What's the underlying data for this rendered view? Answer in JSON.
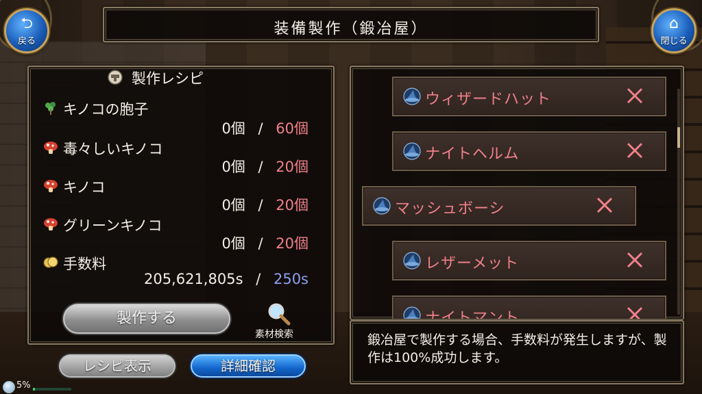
{
  "window": {
    "title": "装備製作（鍛冶屋）"
  },
  "nav": {
    "back": {
      "label": "戻る",
      "icon": "back-arrow-icon"
    },
    "close": {
      "label": "閉じる",
      "icon": "home-icon"
    }
  },
  "recipe": {
    "title": "製作レシピ",
    "materials": [
      {
        "name": "キノコの胞子",
        "have": "0個",
        "sep": "/",
        "need": "60個",
        "icon": "spore-icon"
      },
      {
        "name": "毒々しいキノコ",
        "have": "0個",
        "sep": "/",
        "need": "20個",
        "icon": "mushroom-icon"
      },
      {
        "name": "キノコ",
        "have": "0個",
        "sep": "/",
        "need": "20個",
        "icon": "mushroom-icon"
      },
      {
        "name": "グリーンキノコ",
        "have": "0個",
        "sep": "/",
        "need": "20個",
        "icon": "mushroom-icon"
      }
    ],
    "fee": {
      "name": "手数料",
      "have": "205,621,805s",
      "sep": "/",
      "need": "250s",
      "icon": "coin-icon"
    },
    "make_button": "製作する",
    "search_label": "素材検索"
  },
  "bottom_buttons": {
    "show_recipe": "レシピ表示",
    "details": "詳細確認"
  },
  "status": {
    "percent": "5%",
    "level": 0.05
  },
  "equipment_list": [
    {
      "name": "ウィザードハット",
      "icon": "hat-icon",
      "selected": false
    },
    {
      "name": "ナイトヘルム",
      "icon": "hat-icon",
      "selected": false
    },
    {
      "name": "マッシュボーシ",
      "icon": "hat-icon",
      "selected": true
    },
    {
      "name": "レザーメット",
      "icon": "hat-icon",
      "selected": false
    },
    {
      "name": "ナイトマント",
      "icon": "hat-icon",
      "selected": false
    }
  ],
  "message": "鍛冶屋で製作する場合、手数料が発生しますが、製作は100%成功します。",
  "colors": {
    "required_red": "#f0808a",
    "fee_blue": "#8f9ff0",
    "item_name_red": "#f0808a",
    "button_blue": "#1366cc"
  }
}
